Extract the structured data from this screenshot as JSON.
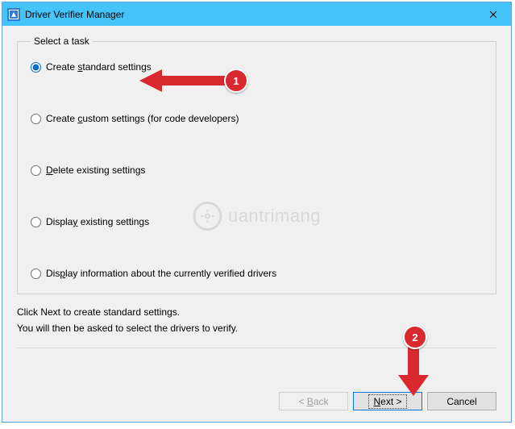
{
  "window": {
    "title": "Driver Verifier Manager"
  },
  "group": {
    "legend": "Select a task"
  },
  "options": {
    "o1": {
      "pre": "Create ",
      "u": "s",
      "post": "tandard settings"
    },
    "o2": {
      "pre": "Create ",
      "u": "c",
      "post": "ustom settings (for code developers)"
    },
    "o3": {
      "pre": "",
      "u": "D",
      "post": "elete existing settings"
    },
    "o4": {
      "pre": "Displa",
      "u": "y",
      "post": " existing settings"
    },
    "o5": {
      "pre": "Dis",
      "u": "p",
      "post": "lay information about the currently verified drivers"
    }
  },
  "selected": "o1",
  "hint": {
    "line1": "Click Next to create standard settings.",
    "line2": "You will then be asked to select the drivers to verify."
  },
  "buttons": {
    "back_pre": "< ",
    "back_u": "B",
    "back_post": "ack",
    "next_pre": "",
    "next_u": "N",
    "next_post": "ext >",
    "cancel": "Cancel"
  },
  "watermark": {
    "text": "uantrimang"
  },
  "annotations": {
    "badge1": "1",
    "badge2": "2"
  }
}
